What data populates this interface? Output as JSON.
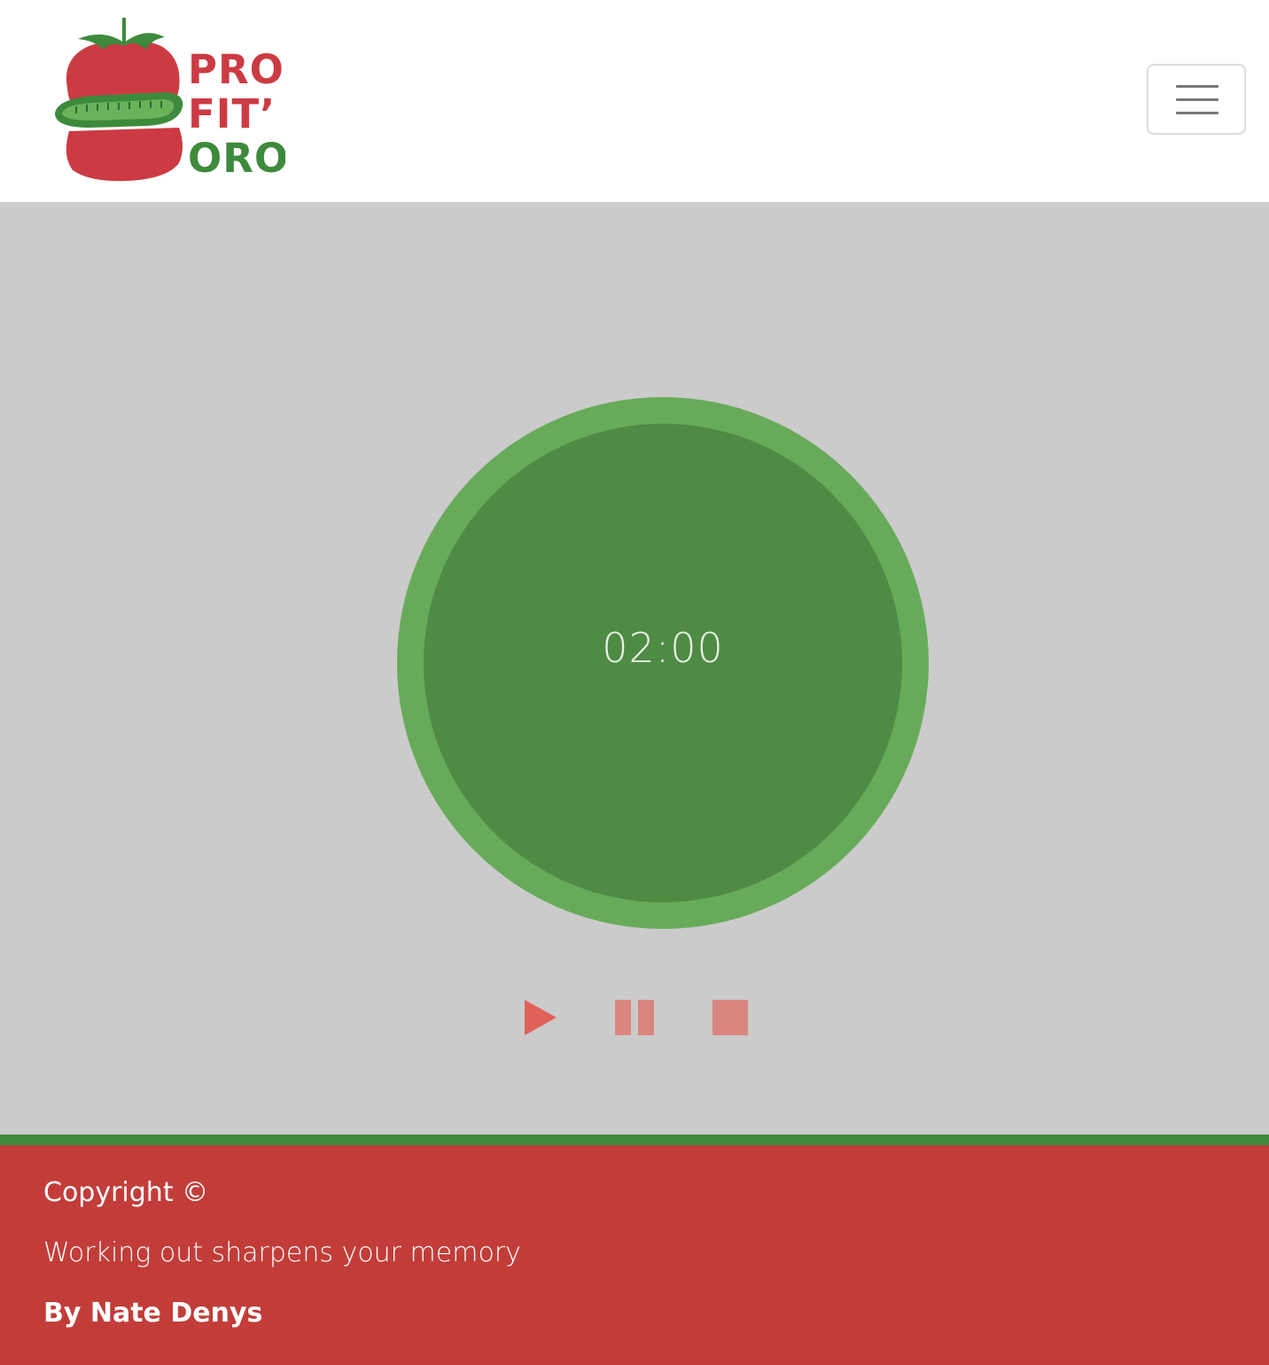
{
  "brand": {
    "line1": "PRO",
    "line2": "FIT’",
    "line3": "ORO",
    "tomato_color": "#cc3b43",
    "leaf_color": "#3e8a3c"
  },
  "nav": {
    "toggle_icon": "hamburger-icon"
  },
  "timer": {
    "display": "02:00",
    "ring_color": "#67ab5a",
    "face_color": "#4f8b44"
  },
  "controls": {
    "play_icon": "play-icon",
    "pause_icon": "pause-icon",
    "stop_icon": "stop-icon",
    "color": "#e0615a"
  },
  "footer": {
    "copyright": "Copyright ©",
    "tagline": "Working out sharpens your memory",
    "author": "By Nate Denys",
    "background": "#c23d39",
    "stripe_color": "#3f8a3a"
  }
}
